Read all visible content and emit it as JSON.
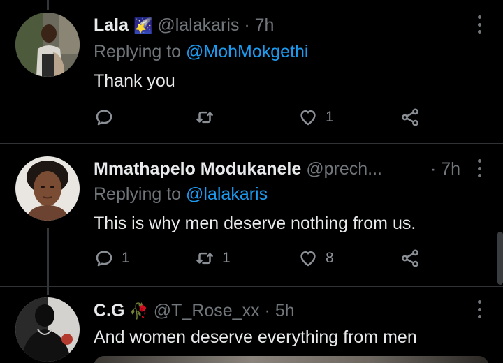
{
  "tweets": [
    {
      "display_name": "Lala",
      "badge": "🌠",
      "handle": "@lalakaris",
      "separator": "·",
      "time": "7h",
      "replying_prefix": "Replying to ",
      "replying_to": "@MohMokgethi",
      "text": "Thank you",
      "replies": "",
      "retweets": "",
      "likes": "1"
    },
    {
      "display_name": "Mmathapelo Modukanele",
      "handle": "@prech...",
      "separator": "·",
      "time": "7h",
      "replying_prefix": "Replying to ",
      "replying_to": "@lalakaris",
      "text": "This is why men deserve nothing from us.",
      "replies": "1",
      "retweets": "1",
      "likes": "8"
    },
    {
      "display_name": "C.G",
      "badge": "🥀",
      "handle": "@T_Rose_xx",
      "separator": "·",
      "time": "5h",
      "text": "And women deserve everything from men"
    }
  ],
  "icons": {
    "reply": "reply-icon",
    "retweet": "retweet-icon",
    "like": "heart-icon",
    "share": "share-icon",
    "more": "more-options-icon"
  },
  "colors": {
    "background": "#000000",
    "text": "#e7e9ea",
    "secondary": "#71767b",
    "link": "#1d9bf0",
    "divider": "#2f3336"
  }
}
